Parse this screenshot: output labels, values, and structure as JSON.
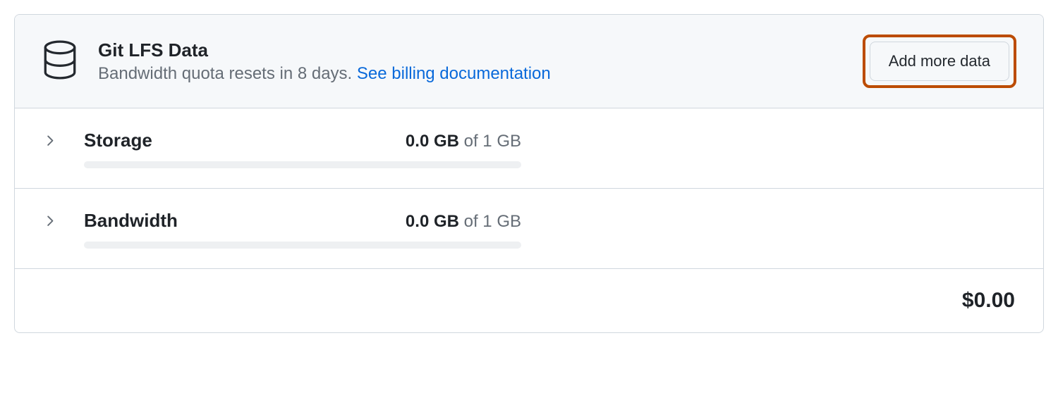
{
  "header": {
    "title": "Git LFS Data",
    "subtitle_prefix": "Bandwidth quota resets in 8 days. ",
    "subtitle_link": "See billing documentation",
    "add_button_label": "Add more data"
  },
  "usage": [
    {
      "label": "Storage",
      "used": "0.0 GB",
      "of_text": " of 1 GB"
    },
    {
      "label": "Bandwidth",
      "used": "0.0 GB",
      "of_text": " of 1 GB"
    }
  ],
  "footer": {
    "total": "$0.00"
  }
}
